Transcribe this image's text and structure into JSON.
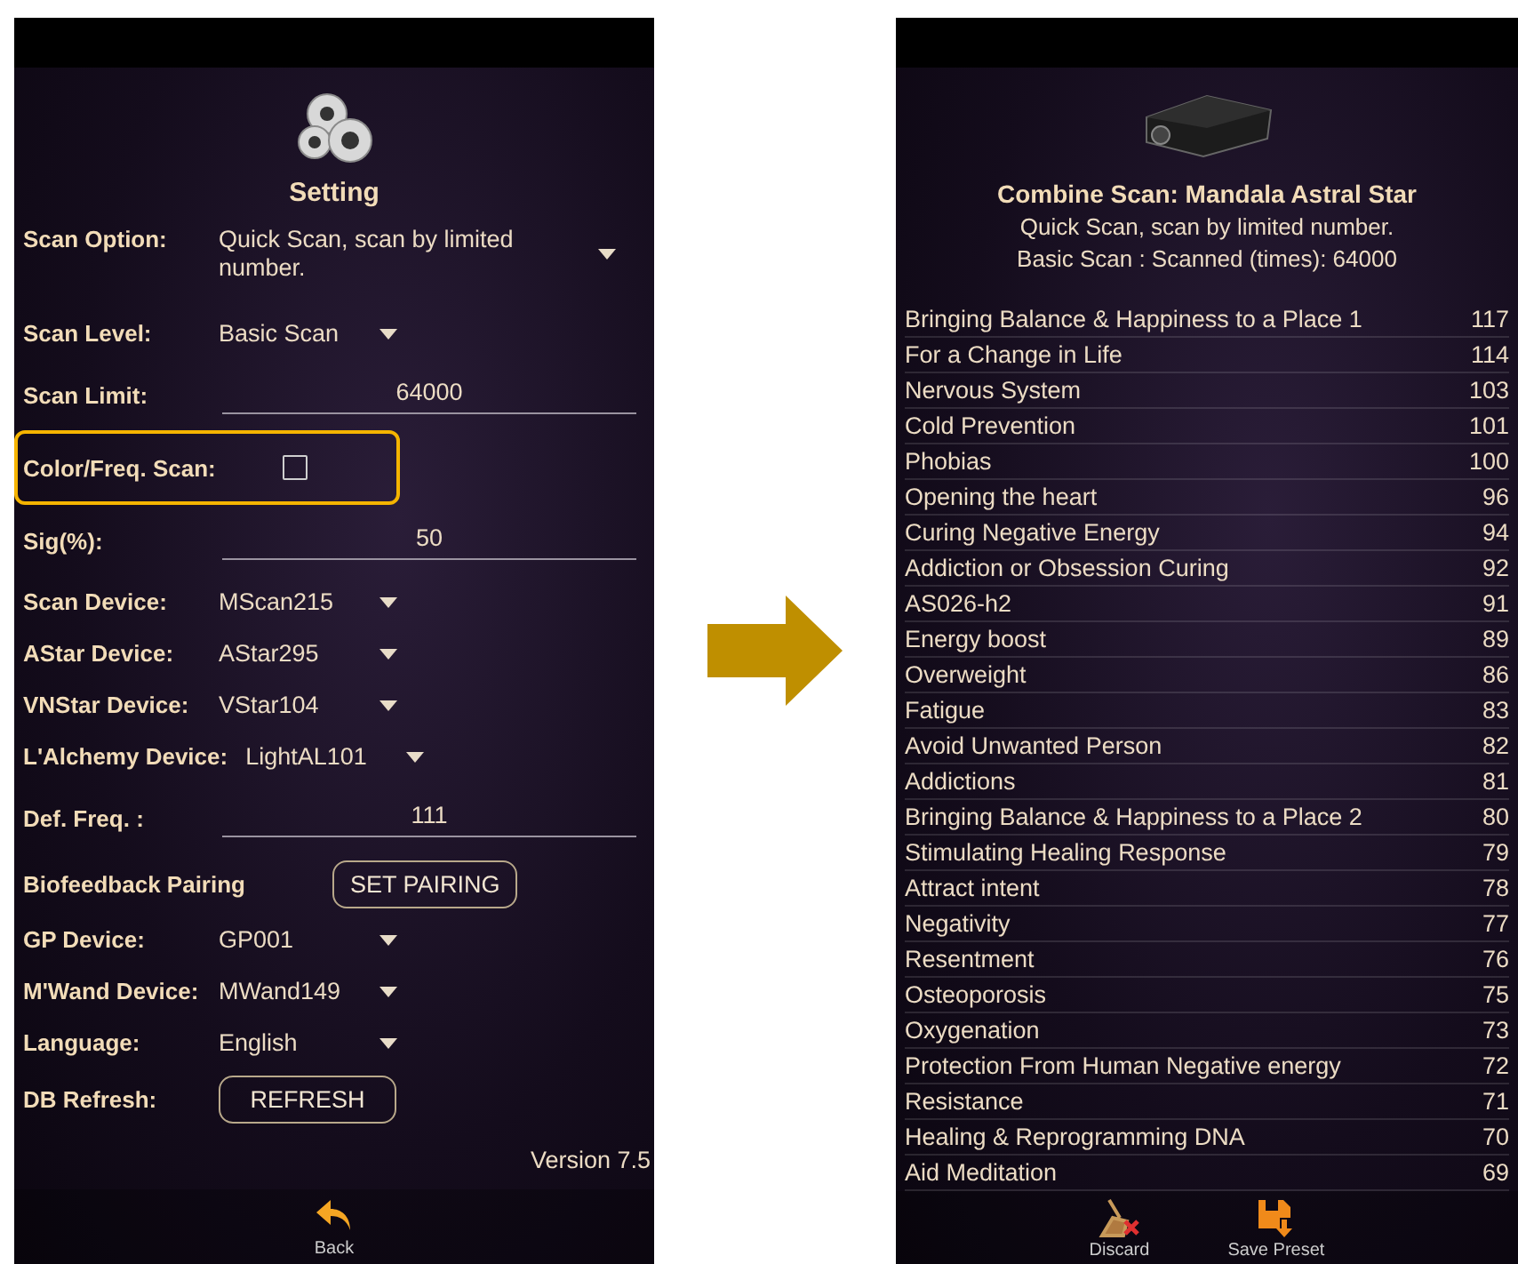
{
  "settings_screen": {
    "title": "Setting",
    "rows": [
      {
        "kind": "dropdown",
        "label": "Scan Option:",
        "value": "Quick Scan, scan by limited number."
      },
      {
        "kind": "dropdown",
        "label": "Scan Level:",
        "value": "Basic Scan"
      },
      {
        "kind": "input",
        "label": "Scan Limit:",
        "value": "64000"
      },
      {
        "kind": "checkbox",
        "label": "Color/Freq. Scan:",
        "checked": false,
        "highlighted": true
      },
      {
        "kind": "input",
        "label": "Sig(%):",
        "value": "50"
      },
      {
        "kind": "dropdown",
        "label": "Scan Device:",
        "value": "MScan215"
      },
      {
        "kind": "dropdown",
        "label": "AStar Device:",
        "value": "AStar295"
      },
      {
        "kind": "dropdown",
        "label": "VNStar Device:",
        "value": "VStar104"
      },
      {
        "kind": "dropdown",
        "label": "L'Alchemy Device:",
        "value": "LightAL101"
      },
      {
        "kind": "input",
        "label": "Def. Freq. :",
        "value": "111"
      },
      {
        "kind": "button",
        "label": "Biofeedback Pairing",
        "value": "SET PAIRING"
      },
      {
        "kind": "dropdown",
        "label": "GP Device:",
        "value": "GP001"
      },
      {
        "kind": "dropdown",
        "label": "M'Wand Device:",
        "value": "MWand149"
      },
      {
        "kind": "dropdown",
        "label": "Language:",
        "value": "English"
      },
      {
        "kind": "button",
        "label": "DB Refresh:",
        "value": "REFRESH"
      }
    ],
    "version": "Version 7.5",
    "bottom_actions": [
      {
        "kind": "back",
        "label": "Back"
      }
    ]
  },
  "results_screen": {
    "title": "Combine Scan: Mandala Astral Star",
    "subtitle": "Quick Scan, scan by limited number.",
    "scan_info": "Basic Scan : Scanned (times): 64000",
    "results": [
      {
        "name": "Bringing Balance & Happiness to a Place 1",
        "count": "117"
      },
      {
        "name": "For a Change in Life",
        "count": "114"
      },
      {
        "name": "Nervous System",
        "count": "103"
      },
      {
        "name": "Cold Prevention",
        "count": "101"
      },
      {
        "name": "Phobias",
        "count": "100"
      },
      {
        "name": "Opening the heart",
        "count": "96"
      },
      {
        "name": "Curing Negative Energy",
        "count": "94"
      },
      {
        "name": "Addiction or Obsession Curing",
        "count": "92"
      },
      {
        "name": "AS026-h2",
        "count": "91"
      },
      {
        "name": "Energy boost",
        "count": "89"
      },
      {
        "name": "Overweight",
        "count": "86"
      },
      {
        "name": "Fatigue",
        "count": "83"
      },
      {
        "name": "Avoid Unwanted Person",
        "count": "82"
      },
      {
        "name": "Addictions",
        "count": "81"
      },
      {
        "name": "Bringing Balance & Happiness to a Place 2",
        "count": "80"
      },
      {
        "name": "Stimulating Healing Response",
        "count": "79"
      },
      {
        "name": "Attract intent",
        "count": "78"
      },
      {
        "name": "Negativity",
        "count": "77"
      },
      {
        "name": "Resentment",
        "count": "76"
      },
      {
        "name": "Osteoporosis",
        "count": "75"
      },
      {
        "name": "Oxygenation",
        "count": "73"
      },
      {
        "name": "Protection From Human Negative energy",
        "count": "72"
      },
      {
        "name": "Resistance",
        "count": "71"
      },
      {
        "name": "Healing & Reprogramming DNA",
        "count": "70"
      },
      {
        "name": "Aid Meditation",
        "count": "69"
      }
    ],
    "bottom_actions": [
      {
        "kind": "discard",
        "label": "Discard"
      },
      {
        "kind": "save",
        "label": "Save Preset"
      }
    ]
  }
}
